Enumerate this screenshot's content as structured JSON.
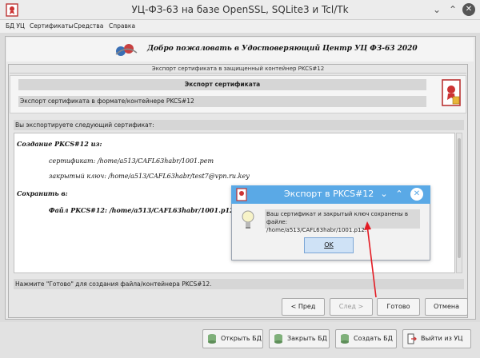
{
  "window": {
    "title": "УЦ-ФЗ-63 на базе OpenSSL, SQLite3 и Tcl/Tk",
    "minimize": "⌄",
    "maximize": "⌃",
    "close": "✕"
  },
  "menu": [
    "БД УЦ",
    "Сертификаты",
    "Средства",
    "Справка"
  ],
  "banner": {
    "title": "Добро пожаловать в Удостоверяющий Центр УЦ ФЗ-63 2020"
  },
  "wizard": {
    "title": "Экспорт сертификата в защищенный контейнер PKCS#12",
    "heading": "Экспорт сертификата",
    "subheading": "Экспорт сертификата в формате/контейнере PKCS#12",
    "intro": "Вы экспортируете следующий сертификат:",
    "content": {
      "creation_label": "Создание PKCS#12 из:",
      "certificate": "сертификат: /home/a513/CAFL63habr/1001.pem",
      "private_key": "закрытый ключ: /home/a513/CAFL63habr/test7@vpn.ru.key",
      "save_label": "Сохранить в:",
      "file": "Файл PKCS#12: /home/a513/CAFL63habr/1001.p12"
    },
    "footer": "Нажмите \"Готово\" для создания файла/контейнера PKCS#12.",
    "buttons": {
      "back": "< Пред",
      "next": "След >",
      "finish": "Готово",
      "cancel": "Отмена"
    }
  },
  "bottom_buttons": {
    "open": "Открыть БД",
    "close": "Закрыть БД",
    "create": "Создать БД",
    "exit": "Выйти из УЦ"
  },
  "dialog": {
    "title": "Экспорт в PKCS#12",
    "message_line1": "Ваш сертификат и закрытый ключ сохранены в файле:",
    "message_line2": "/home/a513/CAFL63habr/1001.p12.",
    "ok": "OK",
    "minimize": "⌄",
    "maximize": "⌃",
    "close": "✕"
  },
  "colors": {
    "dialog_titlebar": "#5aa9e6",
    "arrow": "#e31b23",
    "ok_button": "#cfe2f6"
  },
  "icons": [
    "certificate-icon",
    "lightbulb-icon",
    "database-icon",
    "exit-icon",
    "logo-icon",
    "red-arrow"
  ]
}
